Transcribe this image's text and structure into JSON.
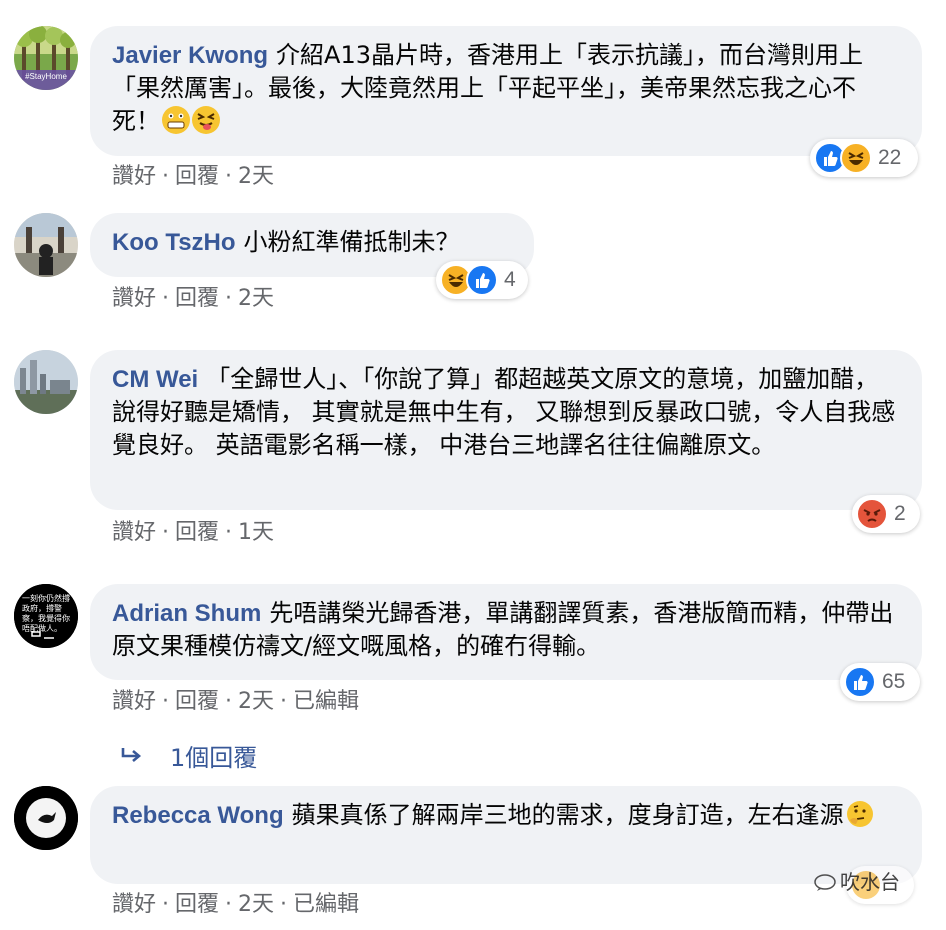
{
  "actions": {
    "like": "讚好",
    "reply": "回覆",
    "sep": "·"
  },
  "comments": [
    {
      "author": "Javier Kwong",
      "text": "介紹A13晶片時，香港用上「表示抗議」，而台灣則用上「果然厲害」。最後，大陸竟然用上「平起平坐」，美帝果然忘我之心不死！",
      "time": "2天",
      "reaction_count": "22",
      "avatar_label": "#StayHome"
    },
    {
      "author": "Koo TszHo",
      "text": "小粉紅準備抵制未？",
      "time": "2天",
      "reaction_count": "4"
    },
    {
      "author": "CM Wei",
      "text": "「全歸世人」、「你說了算」都超越英文原文的意境，加鹽加醋， 說得好聽是矯情， 其實就是無中生有， 又聯想到反暴政口號，令人自我感覺良好。 英語電影名稱一樣， 中港台三地譯名往往偏離原文。",
      "time": "1天",
      "reaction_count": "2"
    },
    {
      "author": "Adrian Shum",
      "text": "先唔講榮光歸香港，單講翻譯質素，香港版簡而精，仲帶出原文果種模仿禱文/經文嘅風格，的確冇得輸。",
      "time": "2天",
      "edited": "已編輯",
      "reaction_count": "65",
      "avatar_label": "一刻你仍然撐政府，撐警察，我覺得你唔配做人。"
    },
    {
      "author": "Rebecca Wong",
      "text": "蘋果真係了解兩岸三地的需求，度身訂造，左右逢源",
      "time": "2天",
      "edited": "已編輯"
    }
  ],
  "replies_label": "1個回覆",
  "watermark": "吹水台",
  "colors": {
    "author": "#385898",
    "bubble": "#f0f2f5",
    "meta": "#65676b",
    "like": "#1877f2"
  }
}
